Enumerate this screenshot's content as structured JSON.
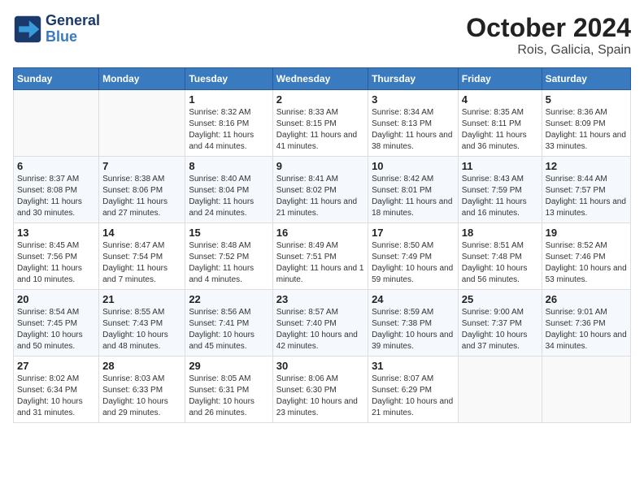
{
  "header": {
    "logo_line1": "General",
    "logo_line2": "Blue",
    "month": "October 2024",
    "location": "Rois, Galicia, Spain"
  },
  "columns": [
    "Sunday",
    "Monday",
    "Tuesday",
    "Wednesday",
    "Thursday",
    "Friday",
    "Saturday"
  ],
  "weeks": [
    [
      {
        "day": "",
        "info": ""
      },
      {
        "day": "",
        "info": ""
      },
      {
        "day": "1",
        "info": "Sunrise: 8:32 AM\nSunset: 8:16 PM\nDaylight: 11 hours and 44 minutes."
      },
      {
        "day": "2",
        "info": "Sunrise: 8:33 AM\nSunset: 8:15 PM\nDaylight: 11 hours and 41 minutes."
      },
      {
        "day": "3",
        "info": "Sunrise: 8:34 AM\nSunset: 8:13 PM\nDaylight: 11 hours and 38 minutes."
      },
      {
        "day": "4",
        "info": "Sunrise: 8:35 AM\nSunset: 8:11 PM\nDaylight: 11 hours and 36 minutes."
      },
      {
        "day": "5",
        "info": "Sunrise: 8:36 AM\nSunset: 8:09 PM\nDaylight: 11 hours and 33 minutes."
      }
    ],
    [
      {
        "day": "6",
        "info": "Sunrise: 8:37 AM\nSunset: 8:08 PM\nDaylight: 11 hours and 30 minutes."
      },
      {
        "day": "7",
        "info": "Sunrise: 8:38 AM\nSunset: 8:06 PM\nDaylight: 11 hours and 27 minutes."
      },
      {
        "day": "8",
        "info": "Sunrise: 8:40 AM\nSunset: 8:04 PM\nDaylight: 11 hours and 24 minutes."
      },
      {
        "day": "9",
        "info": "Sunrise: 8:41 AM\nSunset: 8:02 PM\nDaylight: 11 hours and 21 minutes."
      },
      {
        "day": "10",
        "info": "Sunrise: 8:42 AM\nSunset: 8:01 PM\nDaylight: 11 hours and 18 minutes."
      },
      {
        "day": "11",
        "info": "Sunrise: 8:43 AM\nSunset: 7:59 PM\nDaylight: 11 hours and 16 minutes."
      },
      {
        "day": "12",
        "info": "Sunrise: 8:44 AM\nSunset: 7:57 PM\nDaylight: 11 hours and 13 minutes."
      }
    ],
    [
      {
        "day": "13",
        "info": "Sunrise: 8:45 AM\nSunset: 7:56 PM\nDaylight: 11 hours and 10 minutes."
      },
      {
        "day": "14",
        "info": "Sunrise: 8:47 AM\nSunset: 7:54 PM\nDaylight: 11 hours and 7 minutes."
      },
      {
        "day": "15",
        "info": "Sunrise: 8:48 AM\nSunset: 7:52 PM\nDaylight: 11 hours and 4 minutes."
      },
      {
        "day": "16",
        "info": "Sunrise: 8:49 AM\nSunset: 7:51 PM\nDaylight: 11 hours and 1 minute."
      },
      {
        "day": "17",
        "info": "Sunrise: 8:50 AM\nSunset: 7:49 PM\nDaylight: 10 hours and 59 minutes."
      },
      {
        "day": "18",
        "info": "Sunrise: 8:51 AM\nSunset: 7:48 PM\nDaylight: 10 hours and 56 minutes."
      },
      {
        "day": "19",
        "info": "Sunrise: 8:52 AM\nSunset: 7:46 PM\nDaylight: 10 hours and 53 minutes."
      }
    ],
    [
      {
        "day": "20",
        "info": "Sunrise: 8:54 AM\nSunset: 7:45 PM\nDaylight: 10 hours and 50 minutes."
      },
      {
        "day": "21",
        "info": "Sunrise: 8:55 AM\nSunset: 7:43 PM\nDaylight: 10 hours and 48 minutes."
      },
      {
        "day": "22",
        "info": "Sunrise: 8:56 AM\nSunset: 7:41 PM\nDaylight: 10 hours and 45 minutes."
      },
      {
        "day": "23",
        "info": "Sunrise: 8:57 AM\nSunset: 7:40 PM\nDaylight: 10 hours and 42 minutes."
      },
      {
        "day": "24",
        "info": "Sunrise: 8:59 AM\nSunset: 7:38 PM\nDaylight: 10 hours and 39 minutes."
      },
      {
        "day": "25",
        "info": "Sunrise: 9:00 AM\nSunset: 7:37 PM\nDaylight: 10 hours and 37 minutes."
      },
      {
        "day": "26",
        "info": "Sunrise: 9:01 AM\nSunset: 7:36 PM\nDaylight: 10 hours and 34 minutes."
      }
    ],
    [
      {
        "day": "27",
        "info": "Sunrise: 8:02 AM\nSunset: 6:34 PM\nDaylight: 10 hours and 31 minutes."
      },
      {
        "day": "28",
        "info": "Sunrise: 8:03 AM\nSunset: 6:33 PM\nDaylight: 10 hours and 29 minutes."
      },
      {
        "day": "29",
        "info": "Sunrise: 8:05 AM\nSunset: 6:31 PM\nDaylight: 10 hours and 26 minutes."
      },
      {
        "day": "30",
        "info": "Sunrise: 8:06 AM\nSunset: 6:30 PM\nDaylight: 10 hours and 23 minutes."
      },
      {
        "day": "31",
        "info": "Sunrise: 8:07 AM\nSunset: 6:29 PM\nDaylight: 10 hours and 21 minutes."
      },
      {
        "day": "",
        "info": ""
      },
      {
        "day": "",
        "info": ""
      }
    ]
  ]
}
